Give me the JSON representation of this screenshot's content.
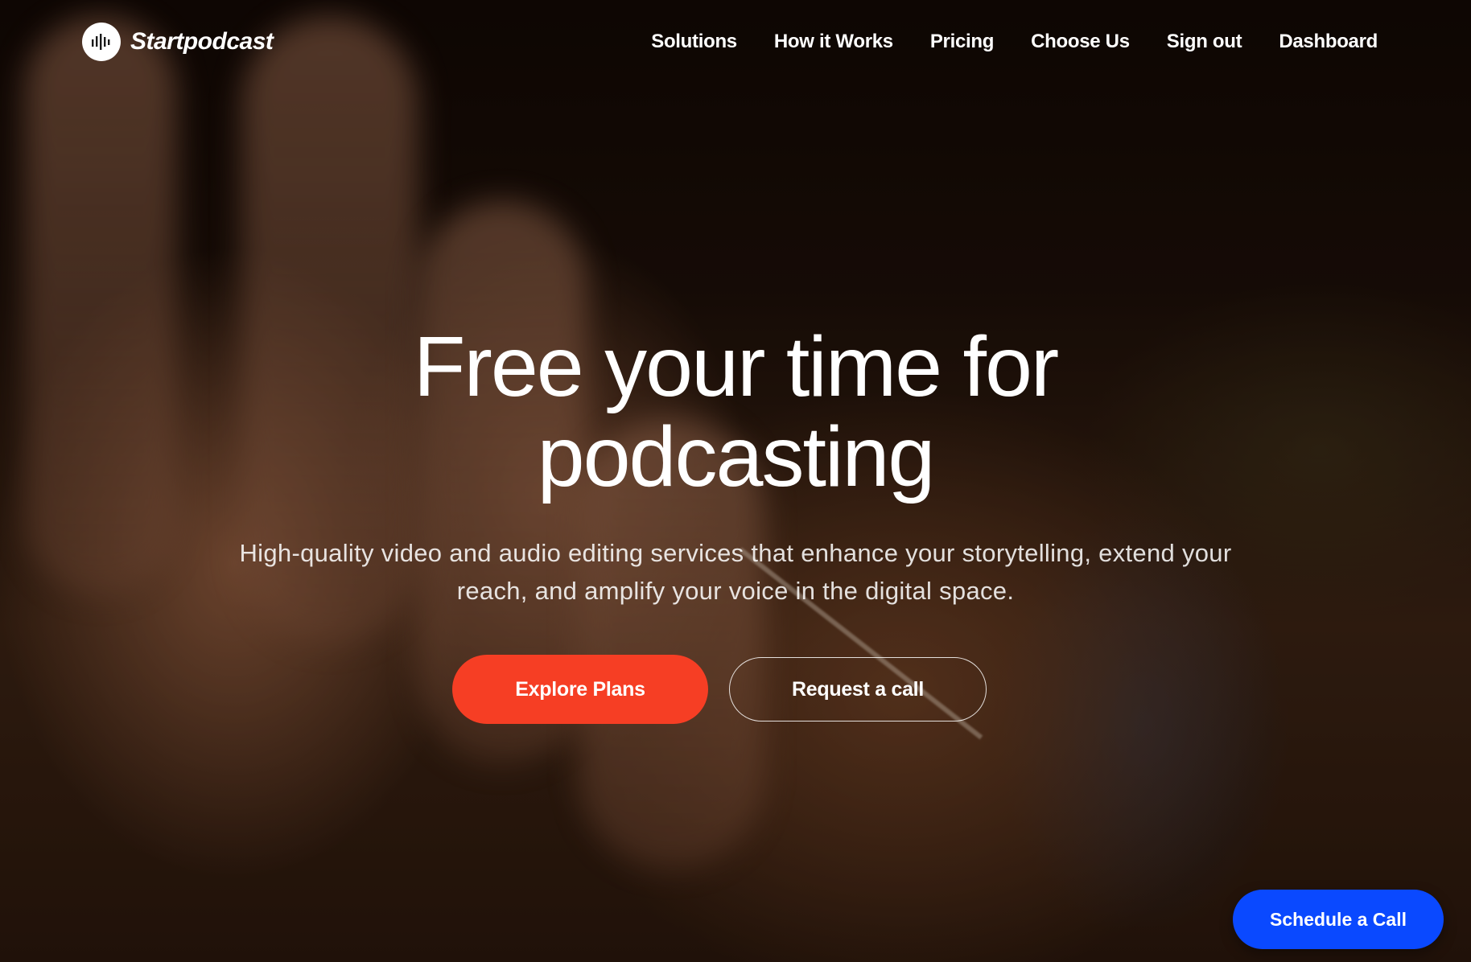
{
  "brand": {
    "name": "Startpodcast",
    "logo_icon": "sound-wave-icon"
  },
  "nav": {
    "items": [
      "Solutions",
      "How it Works",
      "Pricing",
      "Choose Us",
      "Sign out",
      "Dashboard"
    ]
  },
  "hero": {
    "title_line1": "Free your time for",
    "title_line2": "podcasting",
    "subtitle": "High-quality video and audio editing services that enhance your storytelling, extend your reach, and amplify your voice in the digital space.",
    "primary_cta": "Explore Plans",
    "secondary_cta": "Request a call"
  },
  "floating_cta": {
    "label": "Schedule a Call"
  },
  "colors": {
    "primary_button": "#f63e24",
    "floating_button": "#0a49ff",
    "text": "#ffffff"
  }
}
